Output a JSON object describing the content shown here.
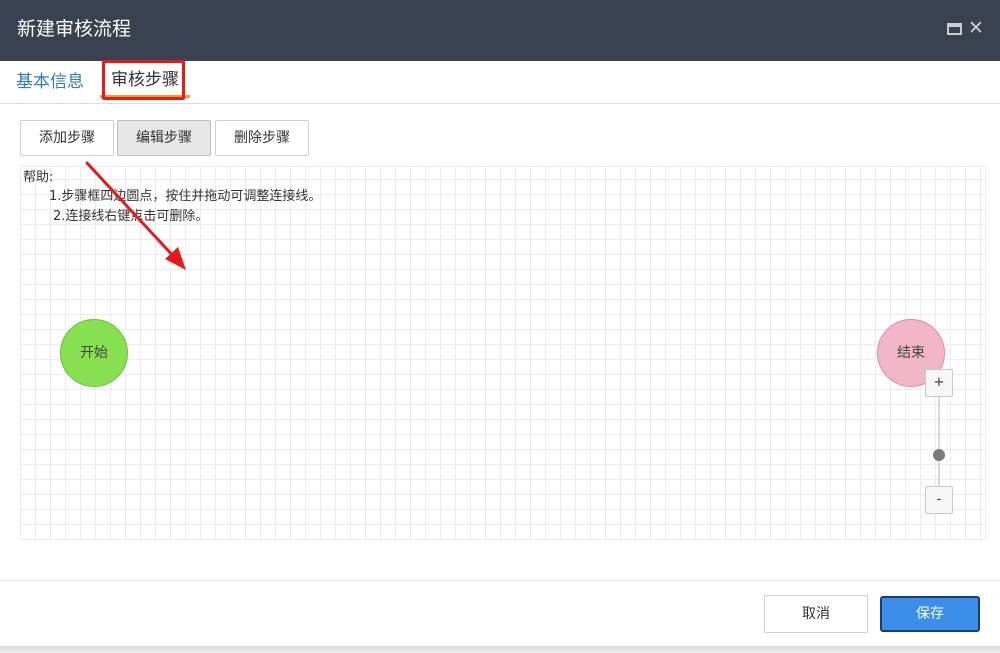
{
  "window": {
    "title": "新建审核流程",
    "maximize_icon": "maximize-icon",
    "close_glyph": "✕"
  },
  "tabs": [
    {
      "label": "基本信息",
      "active": false
    },
    {
      "label": "审核步骤",
      "active": true
    }
  ],
  "toolbar": {
    "add_label": "添加步骤",
    "edit_label": "编辑步骤",
    "delete_label": "删除步骤"
  },
  "help": {
    "title": "帮助:",
    "lines": [
      "1.步骤框四边圆点，按住并拖动可调整连接线。",
      "2.连接线右键点击可删除。"
    ]
  },
  "flow": {
    "nodes": [
      {
        "label": "开始",
        "color": "#86e04f"
      },
      {
        "label": "结束",
        "color": "#f0b6c8"
      }
    ]
  },
  "zoom": {
    "in_label": "+",
    "out_label": "-",
    "level": 0.6
  },
  "footer": {
    "cancel_label": "取消",
    "save_label": "保存"
  },
  "colors": {
    "titlebar": "#3a4150",
    "active_tab_underline": "#f0a21e",
    "annotation": "#e8191c",
    "primary_button": "#3b8fe8"
  }
}
